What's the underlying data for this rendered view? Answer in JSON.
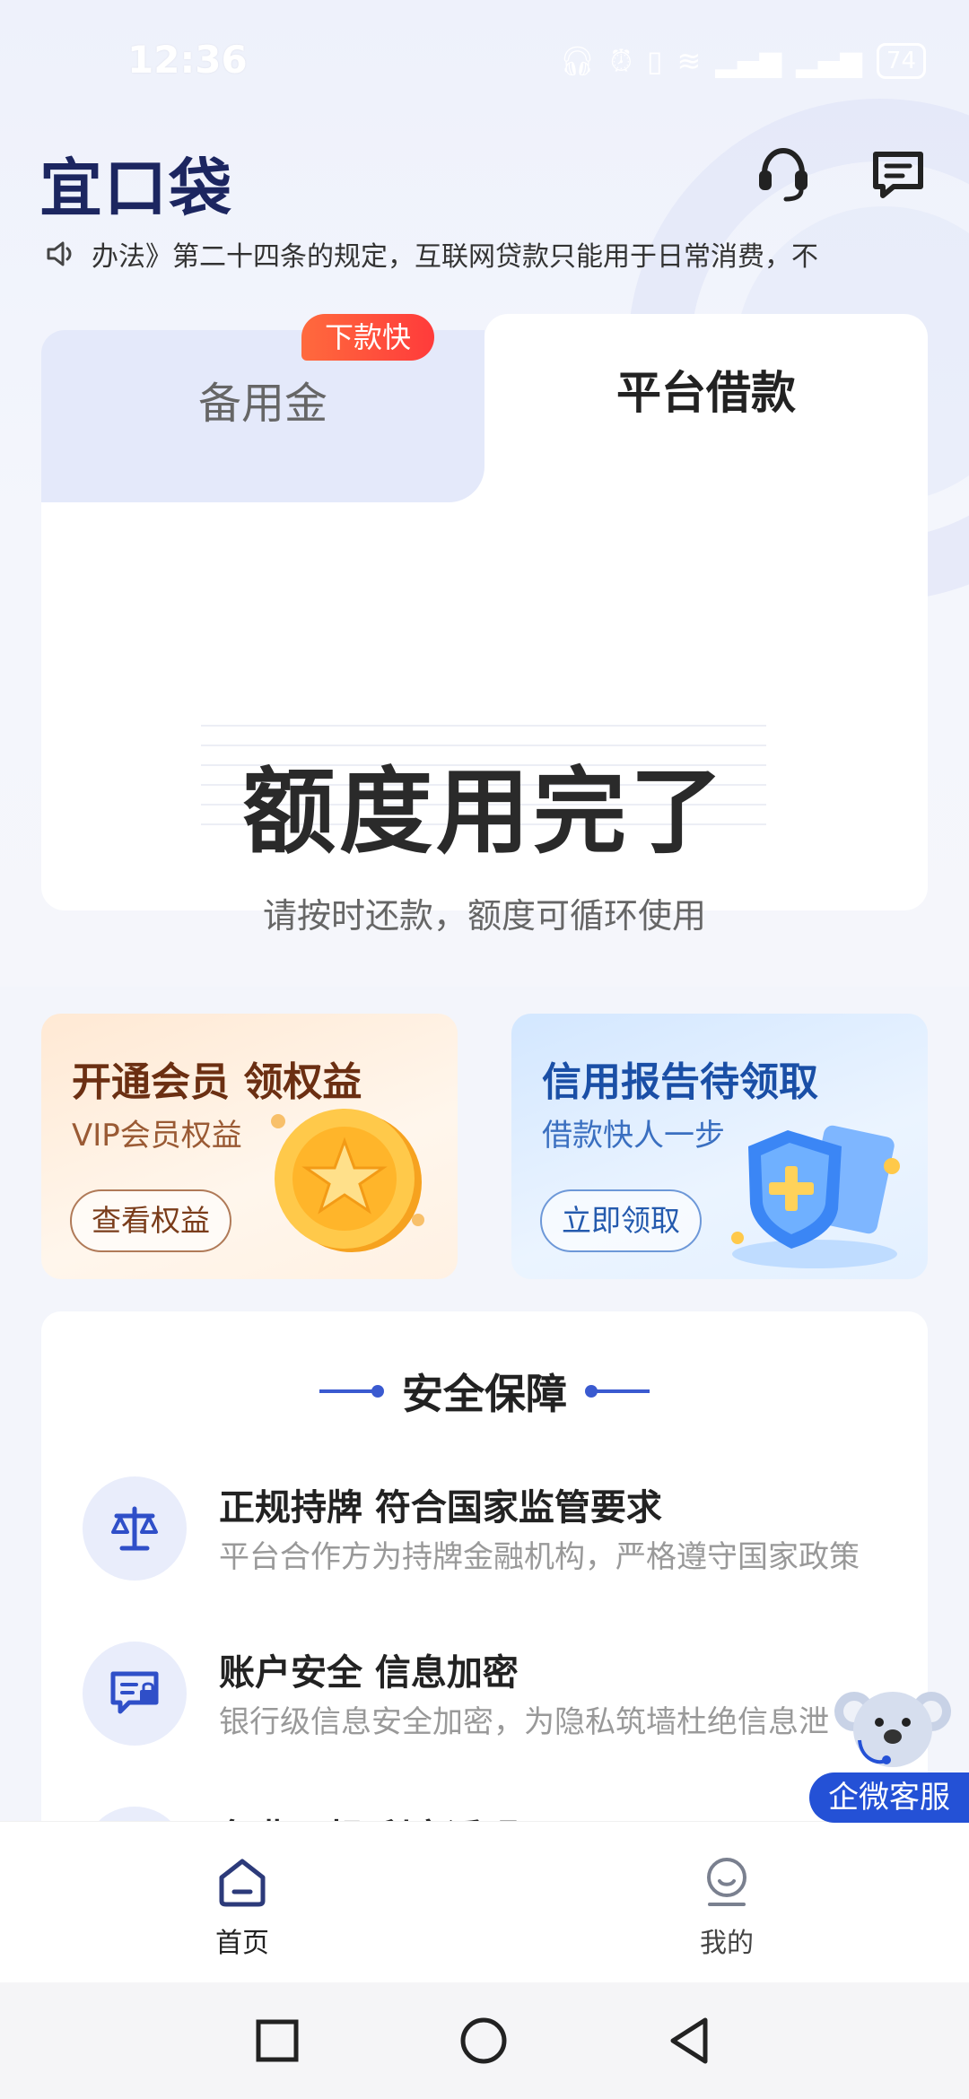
{
  "status_bar": {
    "time": "12:36",
    "battery": "74"
  },
  "header": {
    "logo": "宜口袋"
  },
  "notice": {
    "text": "办法》第二十四条的规定，互联网贷款只能用于日常消费，不"
  },
  "loan_card": {
    "tab_left_label": "备用金",
    "tab_left_badge": "下款快",
    "tab_right_label": "平台借款",
    "main_message": "额度用完了",
    "sub_message": "请按时还款，额度可循环使用"
  },
  "promos": {
    "vip": {
      "title": "开通会员 领权益",
      "subtitle": "VIP会员权益",
      "button": "查看权益"
    },
    "credit": {
      "title": "信用报告待领取",
      "subtitle": "借款快人一步",
      "button": "立即领取"
    }
  },
  "security": {
    "title": "安全保障",
    "items": [
      {
        "title": "正规持牌 符合国家监管要求",
        "desc": "平台合作方为持牌金融机构，严格遵守国家政策"
      },
      {
        "title": "账户安全 信息加密",
        "desc": "银行级信息安全加密，为隐私筑墙杜绝信息泄"
      },
      {
        "title": "免费下想 利率透明",
        "desc": ""
      }
    ]
  },
  "float_service": {
    "label": "企微客服"
  },
  "bottom_nav": {
    "items": [
      {
        "label": "首页",
        "icon": "home-icon",
        "active": true
      },
      {
        "label": "我的",
        "icon": "profile-icon",
        "active": false
      }
    ]
  },
  "colors": {
    "brand": "#1c2660",
    "accent": "#2451d6",
    "badge": "#ff4a3a"
  }
}
